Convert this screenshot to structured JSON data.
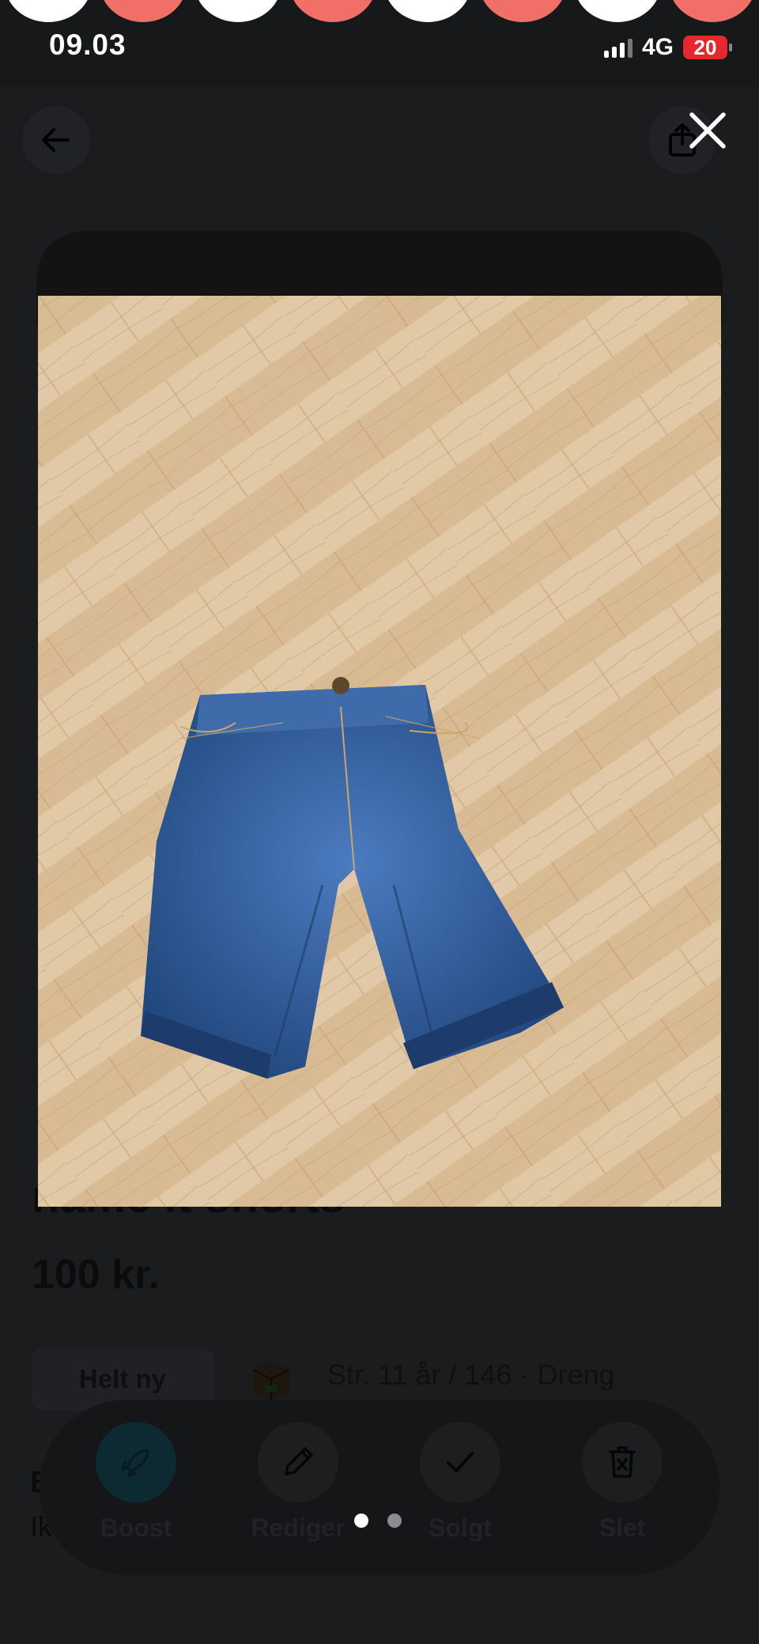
{
  "status_bar": {
    "time": "09.03",
    "network": "4G",
    "battery": "20"
  },
  "listing": {
    "title_peek": "name it shorts",
    "price": "100 kr.",
    "condition_chip": "Helt ny",
    "size_info": "Str. 11 år / 146 · Dreng",
    "section_peek_title": "B",
    "section_peek_text": "Ik"
  },
  "actions": [
    {
      "label": "Boost",
      "icon": "rocket-icon"
    },
    {
      "label": "Rediger",
      "icon": "pencil-icon"
    },
    {
      "label": "Solgt",
      "icon": "check-icon"
    },
    {
      "label": "Slet",
      "icon": "trash-icon"
    }
  ],
  "gallery": {
    "total_images": 2,
    "active_index": 0
  },
  "colors": {
    "background": "#1b1c1e",
    "denim": "#2d5b9c",
    "floor": "#d9bd96",
    "battery_red": "#e5282e",
    "story_coral": "#f07068"
  },
  "icons": {
    "back": "arrow-left-icon",
    "share": "share-icon",
    "close": "close-icon"
  }
}
